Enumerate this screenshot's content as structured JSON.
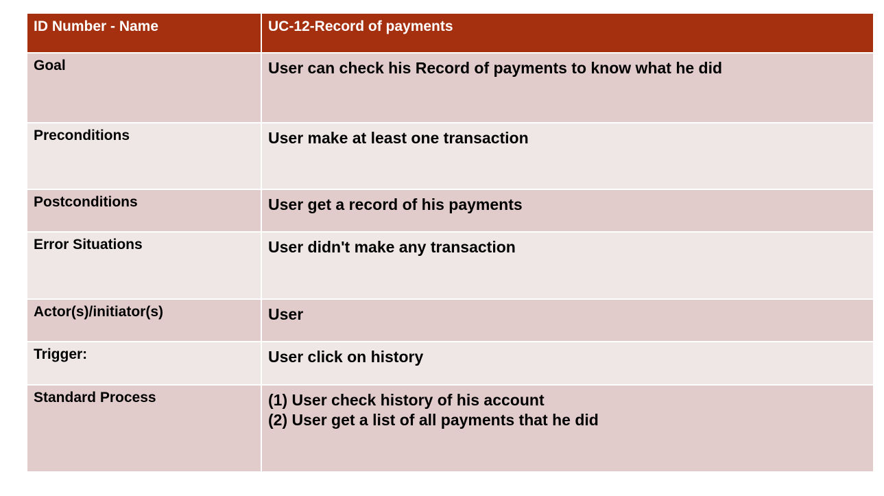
{
  "header": {
    "label": "ID Number - Name",
    "value": "UC-12-Record of payments"
  },
  "rows": [
    {
      "label": "Goal",
      "lines": [
        "User can check his Record of payments to know what he did"
      ]
    },
    {
      "label": "Preconditions",
      "lines": [
        "User make at least one transaction"
      ]
    },
    {
      "label": "Postconditions",
      "lines": [
        "User get a record of his payments"
      ]
    },
    {
      "label": "Error Situations",
      "lines": [
        "User didn't make any transaction"
      ]
    },
    {
      "label": "Actor(s)/initiator(s)",
      "lines": [
        "User"
      ]
    },
    {
      "label": "Trigger:",
      "lines": [
        "User click on history"
      ]
    },
    {
      "label": "Standard Process",
      "lines": [
        "(1) User check history of his account",
        "(2) User get a list of all payments that he did"
      ]
    }
  ],
  "colors": {
    "header_bg": "#a5300f",
    "row_dark": "#e1cccb",
    "row_light": "#efe7e6"
  }
}
